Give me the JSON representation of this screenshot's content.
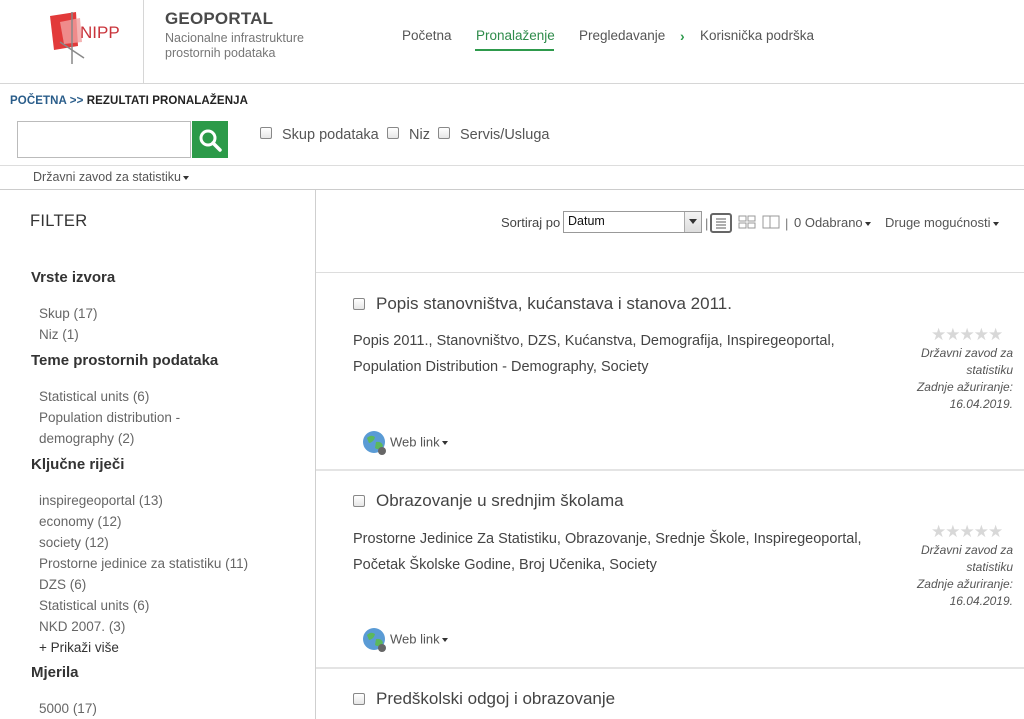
{
  "header": {
    "logo_text": "NIPP",
    "title": "GEOPORTAL",
    "subtitle_line1": "Nacionalne infrastrukture",
    "subtitle_line2": "prostornih podataka",
    "nav": [
      {
        "label": "Početna",
        "active": false
      },
      {
        "label": "Pronalaženje",
        "active": true
      },
      {
        "label": "Pregledavanje",
        "active": false
      },
      {
        "label": "Korisnička podrška",
        "active": false
      }
    ],
    "accent_color": "#2e9a4c"
  },
  "breadcrumb": {
    "home": "POČETNA",
    "separator": ">>",
    "current": "REZULTATI PRONALAŽENJA"
  },
  "search": {
    "value": "",
    "placeholder": "",
    "button_icon": "search-icon",
    "type_filters": [
      "Skup podataka",
      "Niz",
      "Servis/Usluga"
    ]
  },
  "organization": {
    "selected": "Državni zavod za statistiku"
  },
  "filter": {
    "title": "FILTER",
    "groups": [
      {
        "title": "Vrste izvora",
        "items": [
          {
            "label": "Skup",
            "count": "(17)"
          },
          {
            "label": "Niz",
            "count": "(1)"
          }
        ]
      },
      {
        "title": "Teme prostornih podataka",
        "items": [
          {
            "label": "Statistical units",
            "count": "(6)"
          },
          {
            "label": "Population distribution - demography",
            "count": "(2)"
          }
        ]
      },
      {
        "title": "Ključne riječi",
        "items": [
          {
            "label": "inspiregeoportal",
            "count": "(13)"
          },
          {
            "label": "economy",
            "count": "(12)"
          },
          {
            "label": "society",
            "count": "(12)"
          },
          {
            "label": "Prostorne jedinice za statistiku",
            "count": "(11)"
          },
          {
            "label": "DZS",
            "count": "(6)"
          },
          {
            "label": "Statistical units",
            "count": "(6)"
          },
          {
            "label": "NKD 2007.",
            "count": "(3)"
          }
        ],
        "show_more": "+ Prikaži više"
      },
      {
        "title": "Mjerila",
        "items": [
          {
            "label": "5000",
            "count": "(17)"
          }
        ]
      }
    ]
  },
  "toolbar": {
    "sort_label": "Sortiraj po",
    "sort_value": "Datum",
    "selected_count": "0 Odabrano",
    "more_options": "Druge mogućnosti"
  },
  "results": [
    {
      "title": "Popis stanovništva, kućanstava i stanova 2011.",
      "keywords_line1": "Popis 2011., Stanovništvo, DZS, Kućanstva, Demografija, Inspiregeoportal,",
      "keywords_line2": "Population Distribution - Demography, Society",
      "org_line1": "Državni zavod za",
      "org_line2": "statistiku",
      "updated_label_line1": "Zadnje ažuriranje:",
      "updated_date": "16.04.2019.",
      "weblink": "Web link",
      "rating": 0
    },
    {
      "title": "Obrazovanje u srednjim školama",
      "keywords_line1": "Prostorne Jedinice Za Statistiku, Obrazovanje, Srednje Škole, Inspiregeoportal,",
      "keywords_line2": "Početak Školske Godine, Broj Učenika, Society",
      "org_line1": "Državni zavod za",
      "org_line2": "statistiku",
      "updated_label_line1": "Zadnje ažuriranje:",
      "updated_date": "16.04.2019.",
      "weblink": "Web link",
      "rating": 0
    },
    {
      "title": "Predškolski odgoj i obrazovanje"
    }
  ]
}
